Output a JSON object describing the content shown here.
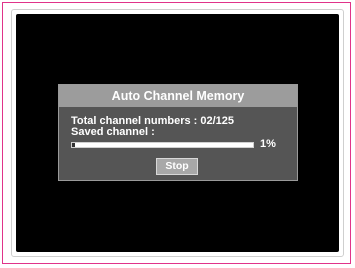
{
  "dialog": {
    "title": "Auto Channel Memory",
    "total_channel_text": "Total channel numbers : 02/125",
    "saved_channel_text": "Saved channel :",
    "progress": {
      "percent": 1,
      "label": "1%"
    },
    "stop_label": "Stop"
  },
  "colors": {
    "frame_border": "#e0338a",
    "screen_background": "#000000",
    "dialog_background": "#555555",
    "header_background": "#9c9c9c",
    "button_background": "#a8a8a8",
    "text": "#ffffff"
  }
}
